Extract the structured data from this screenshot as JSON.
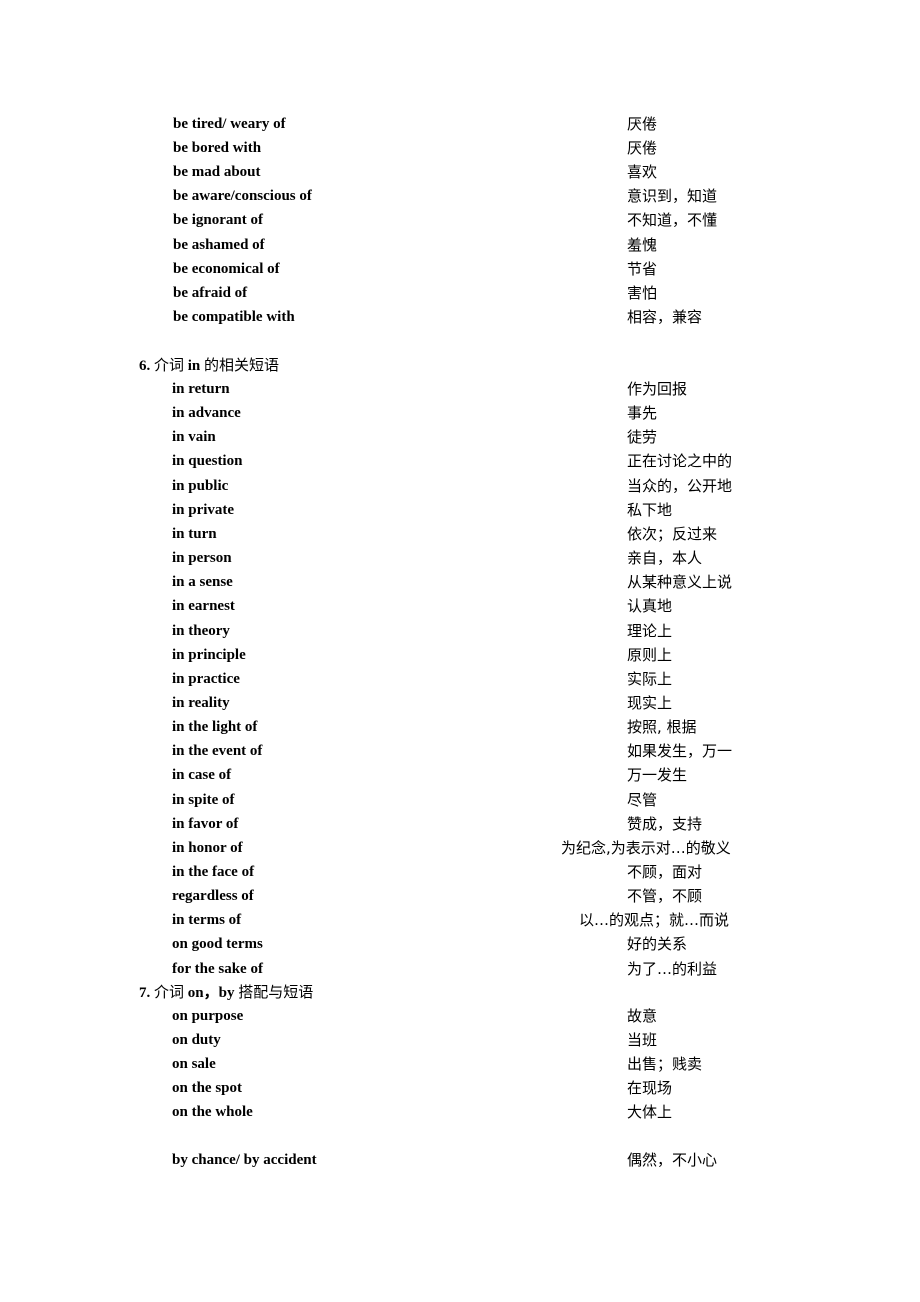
{
  "block1": [
    {
      "en": "be tired/ weary of",
      "zh": "厌倦"
    },
    {
      "en": "be bored with",
      "zh": "厌倦"
    },
    {
      "en": "be mad about",
      "zh": "喜欢"
    },
    {
      "en": "be aware/conscious of",
      "zh": "意识到，知道"
    },
    {
      "en": "be ignorant of",
      "zh": "不知道，不懂"
    },
    {
      "en": "be ashamed of",
      "zh": "羞愧"
    },
    {
      "en": "be economical of",
      "zh": "节省"
    },
    {
      "en": "be afraid of",
      "zh": "害怕"
    },
    {
      "en": "be compatible with",
      "zh": "相容，兼容"
    }
  ],
  "section6": {
    "number": "6.",
    "title_pre": "介词",
    "title_kw": "in",
    "title_post": "的相关短语",
    "items": [
      {
        "en": "in return",
        "zh": "作为回报"
      },
      {
        "en": "in advance",
        "zh": "事先"
      },
      {
        "en": "in vain",
        "zh": "徒劳"
      },
      {
        "en": "in question",
        "zh": "正在讨论之中的"
      },
      {
        "en": "in public",
        "zh": "当众的，公开地"
      },
      {
        "en": "in private",
        "zh": "私下地"
      },
      {
        "en": "in turn",
        "zh": "依次；反过来"
      },
      {
        "en": "in person",
        "zh": "亲自，本人"
      },
      {
        "en": "in a sense",
        "zh": "从某种意义上说"
      },
      {
        "en": "in earnest",
        "zh": "认真地"
      },
      {
        "en": "in theory",
        "zh": "理论上"
      },
      {
        "en": "in principle",
        "zh": "原则上"
      },
      {
        "en": "in practice",
        "zh": "实际上"
      },
      {
        "en": "in reality",
        "zh": "现实上"
      },
      {
        "en": "in the light of",
        "zh": "按照, 根据"
      },
      {
        "en": "in the event of",
        "zh": "如果发生，万一"
      },
      {
        "en": "in case of",
        "zh": "万一发生"
      },
      {
        "en": "in spite of",
        "zh": "尽管"
      },
      {
        "en": "in favor of",
        "zh": "赞成，支持"
      },
      {
        "en": "in honor of",
        "zh": "为纪念,为表示对…的敬义"
      },
      {
        "en": "in the face of",
        "zh": "不顾，面对"
      },
      {
        "en": "regardless of",
        "zh": "不管，不顾"
      },
      {
        "en": "in terms of",
        "zh": "以…的观点；就…而说"
      },
      {
        "en": "on good terms",
        "zh": "好的关系"
      },
      {
        "en": "for the sake of",
        "zh": "为了…的利益"
      }
    ]
  },
  "section7": {
    "number": "7.",
    "title_pre": "介词",
    "title_kw": "on，by",
    "title_post": "搭配与短语",
    "items": [
      {
        "en": "on purpose",
        "zh": "故意"
      },
      {
        "en": "on duty",
        "zh": "当班"
      },
      {
        "en": "on sale",
        "zh": "出售；贱卖"
      },
      {
        "en": "on the spot",
        "zh": "在现场"
      },
      {
        "en": "on the whole",
        "zh": "大体上"
      }
    ],
    "items_after_gap": [
      {
        "en": "by chance/ by accident",
        "zh": "偶然，不小心"
      }
    ]
  }
}
